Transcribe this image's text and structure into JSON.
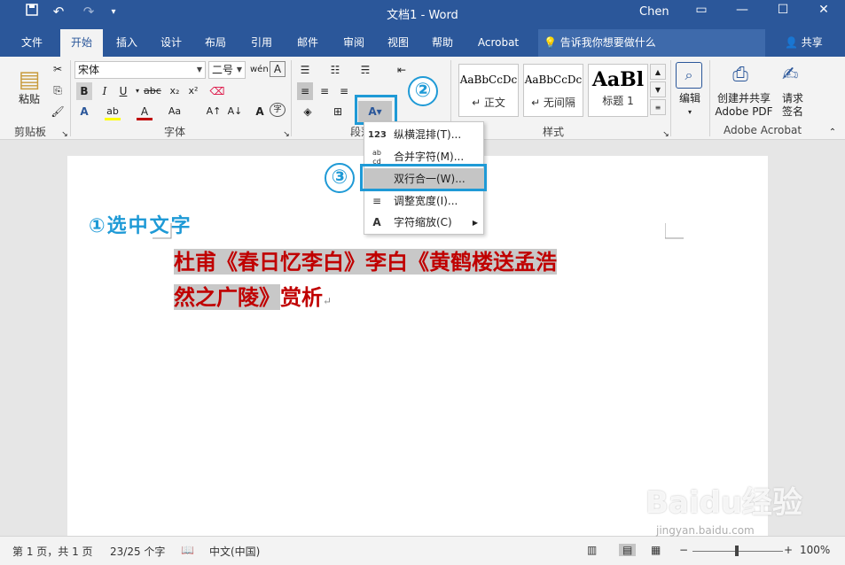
{
  "titlebar": {
    "doc_title": "文档1  -  Word",
    "user": "Chen",
    "save_icon": "save-icon",
    "undo_icon": "undo-icon",
    "redo_icon": "redo-icon"
  },
  "tabs": [
    "文件",
    "开始",
    "插入",
    "设计",
    "布局",
    "引用",
    "邮件",
    "审阅",
    "视图",
    "帮助",
    "Acrobat"
  ],
  "active_tab": "开始",
  "tellme": "告诉我你想要做什么",
  "share": "共享",
  "ribbon": {
    "clipboard": {
      "paste": "粘贴",
      "label": "剪贴板"
    },
    "font": {
      "name": "宋体",
      "size": "二号",
      "label": "字体"
    },
    "paragraph": {
      "label": "段落"
    },
    "styles": {
      "label": "样式",
      "cards": [
        {
          "sample": "AaBbCcDc",
          "name": "↵ 正文"
        },
        {
          "sample": "AaBbCcDc",
          "name": "↵ 无间隔"
        },
        {
          "sample": "AaBl",
          "name": "标题 1"
        }
      ]
    },
    "editing": {
      "label": "编辑"
    },
    "acrobat": {
      "create_line1": "创建并共享",
      "create_line2": "Adobe PDF",
      "sign_line1": "请求",
      "sign_line2": "签名",
      "label": "Adobe Acrobat"
    }
  },
  "annotations": {
    "step1": "①选中文字",
    "step2": "②",
    "step3": "③"
  },
  "document": {
    "line1": "杜甫《春日忆李白》李白《黄鹤楼送孟浩",
    "line2_selected": "然之广陵》",
    "line2_rest": "赏析",
    "para_mark": "↵"
  },
  "menu": {
    "items": [
      {
        "icon": "123",
        "label": "纵横混排(T)..."
      },
      {
        "icon": "ab cd",
        "label": "合并字符(M)..."
      },
      {
        "icon": "",
        "label": "双行合一(W)..."
      },
      {
        "icon": "≡",
        "label": "调整宽度(I)..."
      },
      {
        "icon": "A",
        "label": "字符缩放(C)"
      }
    ],
    "highlighted_index": 2
  },
  "status": {
    "page": "第 1 页，共 1 页",
    "words": "23/25 个字",
    "language": "中文(中国)",
    "zoom": "100%"
  },
  "watermark": {
    "main": "Baidu经验",
    "sub": "jingyan.baidu.com"
  },
  "colors": {
    "brand": "#2b579a",
    "annotation": "#1f9ad6",
    "doc_text": "#c00000"
  }
}
